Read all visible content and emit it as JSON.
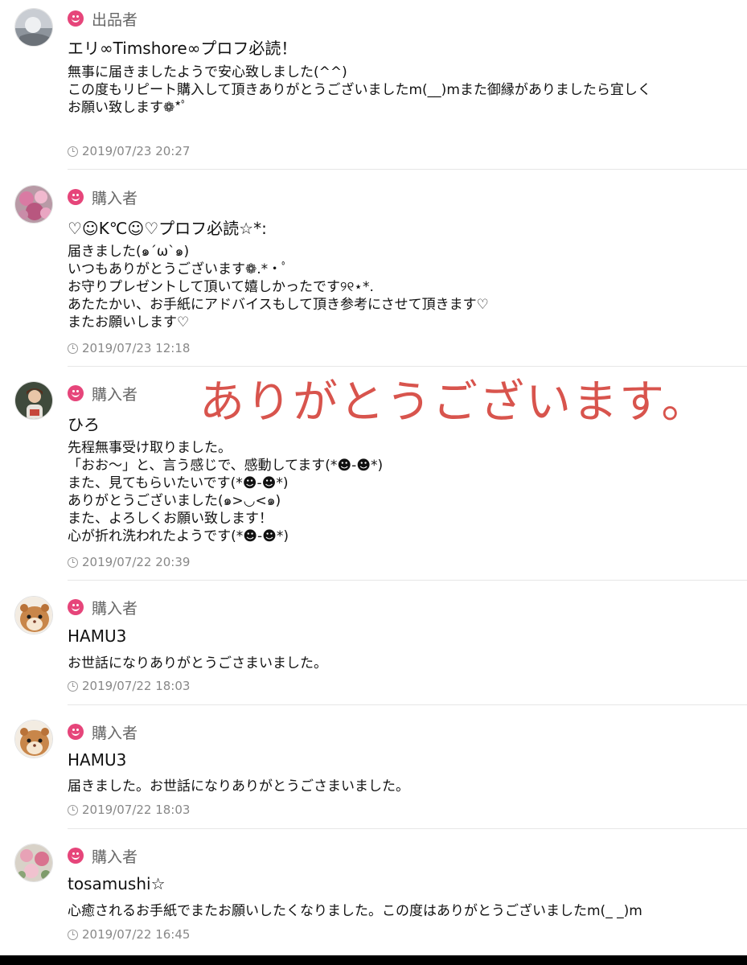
{
  "colors": {
    "role_icon": "#e6457a",
    "overlay_text": "#d8544d",
    "timestamp": "#888888"
  },
  "overlay_text": "ありがとうございます。",
  "comments": [
    {
      "role": "出品者",
      "name": "エリ∞Timshore∞プロフ必読！",
      "body": "無事に届きましたようで安心致しました(^^)\nこの度もリピート購入して頂きありがとうございましたm(__)mまた御縁がありましたら宜しく\nお願い致します❁*ﾟ",
      "timestamp": "2019/07/23 20:27",
      "avatar_icon": "seller-avatar"
    },
    {
      "role": "購入者",
      "name": "♡☺K℃☺♡プロフ必読☆*:",
      "body": "届きました(๑´ω`๑)\nいつもありがとうございます❁.*・ﾟ\nお守りプレゼントして頂いて嬉しかったです୨୧⋆*.\nあたたかい、お手紙にアドバイスもして頂き参考にさせて頂きます♡\nまたお願いします♡",
      "timestamp": "2019/07/23 12:18",
      "avatar_icon": "flower-avatar"
    },
    {
      "role": "購入者",
      "name": "ひろ",
      "body": "先程無事受け取りました。\n「おお〜」と、言う感じで、感動してます(*☻-☻*)\nまた、見てもらいたいです(*☻-☻*)\nありがとうございました(๑>◡<๑)\nまた、よろしくお願い致します！\n心が折れ洗われたようです(*☻-☻*)",
      "timestamp": "2019/07/22 20:39",
      "avatar_icon": "person-avatar"
    },
    {
      "role": "購入者",
      "name": "HAMU3",
      "body": "お世話になりありがとうごさまいました。",
      "timestamp": "2019/07/22 18:03",
      "avatar_icon": "hamster-avatar"
    },
    {
      "role": "購入者",
      "name": "HAMU3",
      "body": "届きました。お世話になりありがとうごさまいました。",
      "timestamp": "2019/07/22 18:03",
      "avatar_icon": "hamster-avatar"
    },
    {
      "role": "購入者",
      "name": "tosamushi☆",
      "body": "心癒されるお手紙でまたお願いしたくなりました。この度はありがとうございましたm(_ _)m",
      "timestamp": "2019/07/22 16:45",
      "avatar_icon": "flower-pink-avatar"
    }
  ]
}
